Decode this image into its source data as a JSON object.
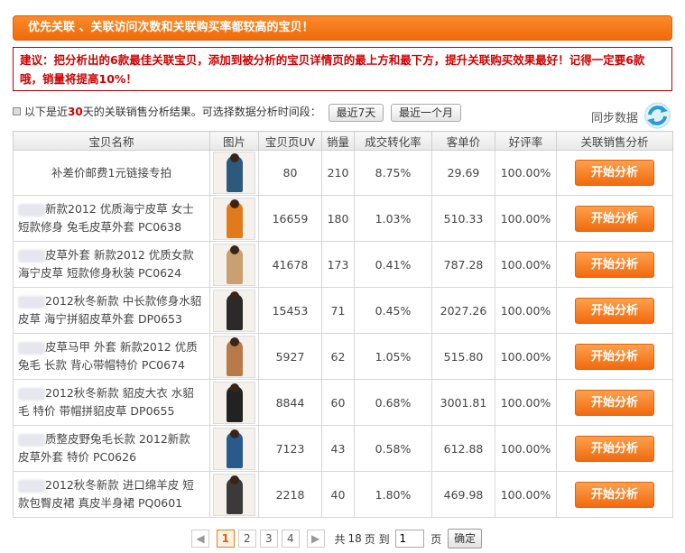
{
  "banner": {
    "text": "优先关联 、关联访问次数和关联购买率都较高的宝贝！"
  },
  "advice": {
    "text": "建议：把分析出的6款最佳关联宝贝，添加到被分析的宝贝详情页的最上方和最下方，提升关联购买效果最好！记得一定要6款哦，销量将提高10%！"
  },
  "info": {
    "prefix": "以下是近",
    "days": "30",
    "suffix": "天的关联销售分析结果。可选择数据分析时间段：",
    "btn_7days": "最近7天",
    "btn_month": "最近一个月"
  },
  "sync": {
    "label": "同步数据",
    "icon": "refresh-icon"
  },
  "table": {
    "headers": [
      "宝贝名称",
      "图片",
      "宝贝页UV",
      "销量",
      "成交转化率",
      "客单价",
      "好评率",
      "关联销售分析"
    ],
    "action_label": "开始分析",
    "rows": [
      {
        "name": "补差价邮费1元链接专拍",
        "uv": "80",
        "sales": "210",
        "conversion": "8.75%",
        "price": "29.69",
        "rating": "100.00%",
        "color": "#2d5a7a"
      },
      {
        "name": "新款2012 优质海宁皮草 女士 短款修身 兔毛皮草外套 PC0638",
        "uv": "16659",
        "sales": "180",
        "conversion": "1.03%",
        "price": "510.33",
        "rating": "100.00%",
        "color": "#e07a1a"
      },
      {
        "name": "皮草外套 新款2012 优质女款 海宁皮草 短款修身秋装 PC0624",
        "uv": "41678",
        "sales": "173",
        "conversion": "0.41%",
        "price": "787.28",
        "rating": "100.00%",
        "color": "#c9a070"
      },
      {
        "name": "2012秋冬新款 中长款修身水貂皮草 海宁拼貂皮草外套 DP0653",
        "uv": "15453",
        "sales": "71",
        "conversion": "0.45%",
        "price": "2027.26",
        "rating": "100.00%",
        "color": "#2a2a2a"
      },
      {
        "name": "皮草马甲 外套 新款2012 优质兔毛 长款 背心带帽特价 PC0674",
        "uv": "5927",
        "sales": "62",
        "conversion": "1.05%",
        "price": "515.80",
        "rating": "100.00%",
        "color": "#b87a4a"
      },
      {
        "name": "2012秋冬新款 貂皮大衣 水貂毛 特价 带帽拼貂皮草 DP0655",
        "uv": "8844",
        "sales": "60",
        "conversion": "0.68%",
        "price": "3001.81",
        "rating": "100.00%",
        "color": "#222222"
      },
      {
        "name": "质整皮野兔毛长款 2012新款 皮草外套 特价 PC0626",
        "uv": "7123",
        "sales": "43",
        "conversion": "0.58%",
        "price": "612.88",
        "rating": "100.00%",
        "color": "#2a5a8a"
      },
      {
        "name": "2012秋冬新款 进口绵羊皮 短款包臀皮裙 真皮半身裙 PQ0601",
        "uv": "2218",
        "sales": "40",
        "conversion": "1.80%",
        "price": "469.98",
        "rating": "100.00%",
        "color": "#3a3a3a"
      }
    ]
  },
  "pager": {
    "prev_icon": "chevron-left-icon",
    "next_icon": "chevron-right-icon",
    "pages": [
      "1",
      "2",
      "3",
      "4"
    ],
    "current": "1",
    "total_prefix": "共",
    "total": "18",
    "total_suffix": "页 到",
    "goto_value": "1",
    "page_unit": "页",
    "ok_label": "确定"
  }
}
